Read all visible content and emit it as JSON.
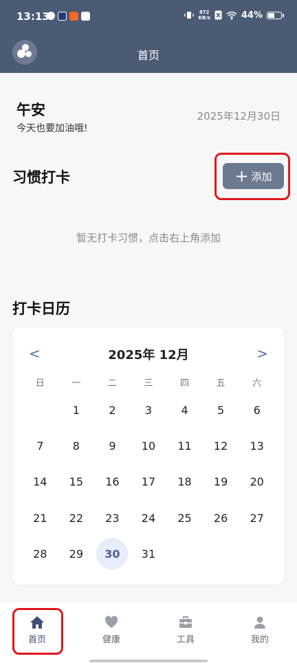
{
  "status_bar": {
    "time": "13:13",
    "net_speed_value": "872",
    "net_speed_unit": "KB/s",
    "battery_percent": "44%",
    "battery_level": 0.44
  },
  "app_bar": {
    "title": "首页",
    "logo_icon": "bubbles-logo-icon"
  },
  "greeting": {
    "title": "午安",
    "subtitle": "今天也要加油哦!",
    "date": "2025年12月30日"
  },
  "habits": {
    "title": "习惯打卡",
    "add_label": "添加",
    "empty_text": "暂无打卡习惯，点击右上角添加"
  },
  "calendar": {
    "title": "打卡日历",
    "month_label": "2025年 12月",
    "prev": "<",
    "next": ">",
    "weekdays": [
      "日",
      "一",
      "二",
      "三",
      "四",
      "五",
      "六"
    ],
    "weeks": [
      [
        "",
        "1",
        "2",
        "3",
        "4",
        "5",
        "6"
      ],
      [
        "7",
        "8",
        "9",
        "10",
        "11",
        "12",
        "13"
      ],
      [
        "14",
        "15",
        "16",
        "17",
        "18",
        "19",
        "20"
      ],
      [
        "21",
        "22",
        "23",
        "24",
        "25",
        "26",
        "27"
      ],
      [
        "28",
        "29",
        "30",
        "31",
        "",
        "",
        ""
      ]
    ],
    "today": "30"
  },
  "tabs": [
    {
      "label": "首页",
      "icon": "home-icon",
      "active": true
    },
    {
      "label": "健康",
      "icon": "heart-icon",
      "active": false
    },
    {
      "label": "工具",
      "icon": "toolbox-icon",
      "active": false
    },
    {
      "label": "我的",
      "icon": "person-icon",
      "active": false
    }
  ],
  "colors": {
    "header": "#4c5b74",
    "accent": "#3f5077",
    "button": "#6c7a90",
    "highlight": "#e0161e"
  }
}
